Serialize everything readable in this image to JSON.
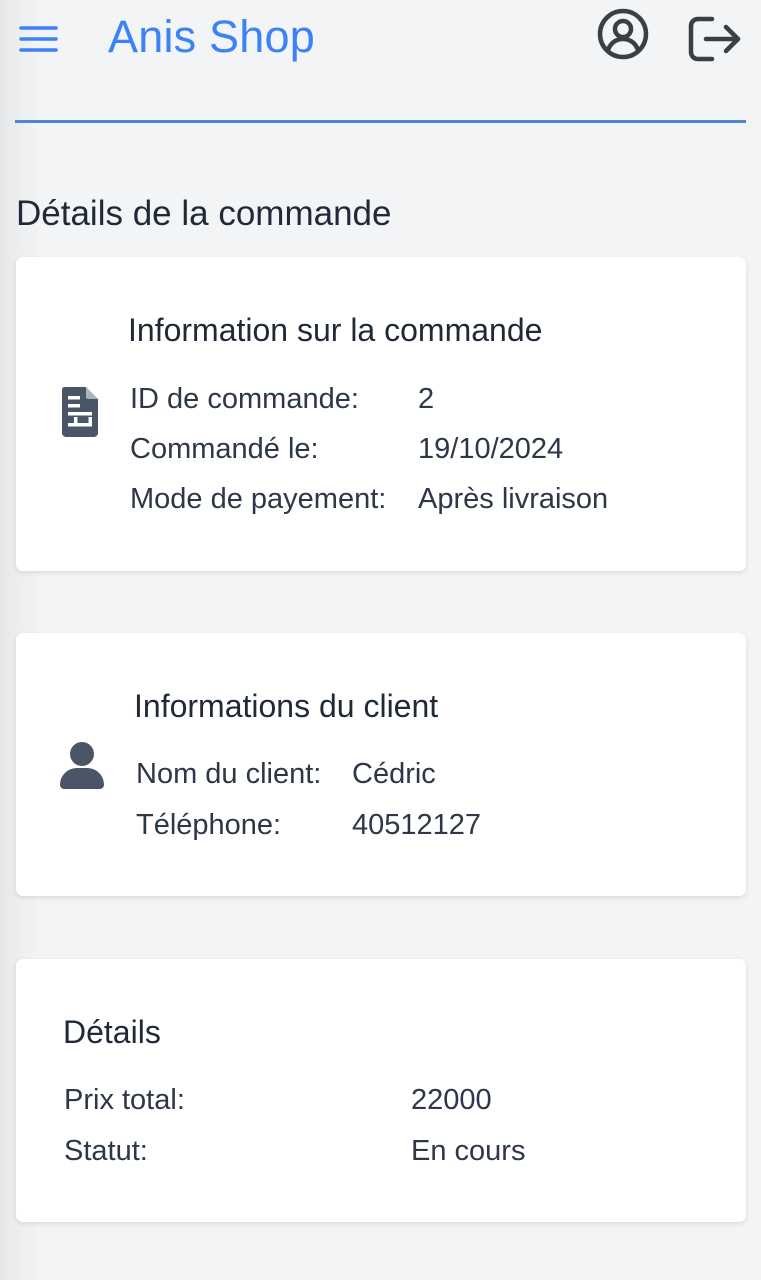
{
  "header": {
    "app_title": "Anis Shop",
    "menu_icon": "hamburger-menu-icon",
    "profile_icon": "user-circle-icon",
    "logout_icon": "logout-icon",
    "accent_color": "#3b82f6"
  },
  "page": {
    "title": "Détails de la commande"
  },
  "order_card": {
    "icon": "document-icon",
    "title": "Information sur la commande",
    "rows": [
      {
        "label": "ID de commande:",
        "value": "2"
      },
      {
        "label": "Commandé le:",
        "value": "19/10/2024"
      },
      {
        "label": "Mode de payement:",
        "value": "Après livraison"
      }
    ]
  },
  "client_card": {
    "icon": "user-icon",
    "title": "Informations du client",
    "rows": [
      {
        "label": "Nom du client:",
        "value": "Cédric"
      },
      {
        "label": "Téléphone:",
        "value": "40512127"
      }
    ]
  },
  "details_card": {
    "title": "Détails",
    "rows": [
      {
        "label": "Prix total:",
        "value": "22000"
      },
      {
        "label": "Statut:",
        "value": "En cours"
      }
    ]
  }
}
